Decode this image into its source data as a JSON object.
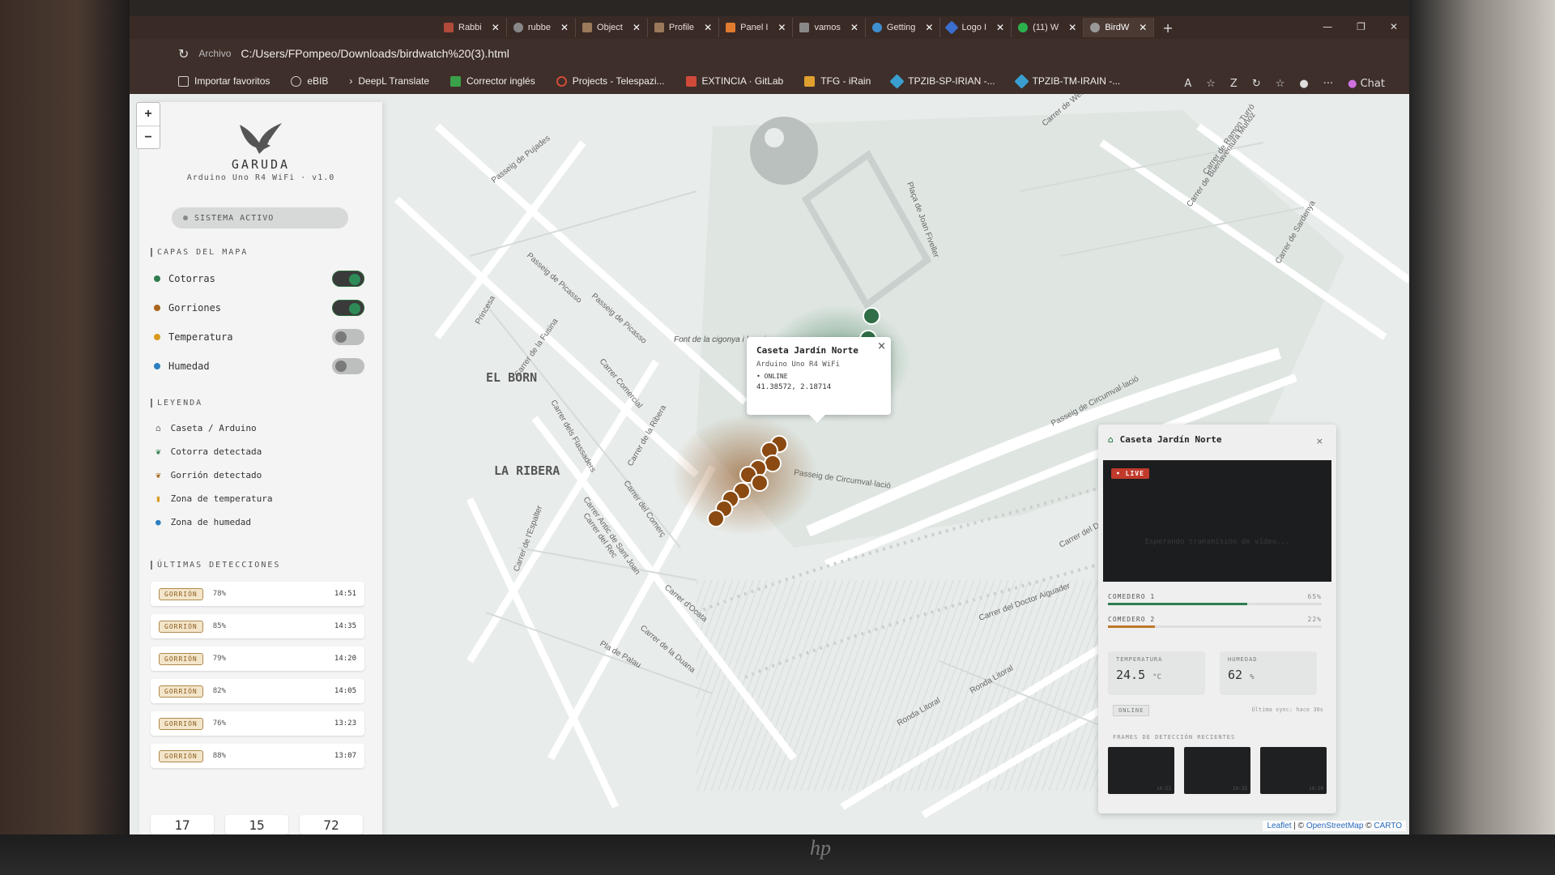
{
  "browser": {
    "tabs": [
      {
        "label": "Rabbi",
        "color": "#b04a3a"
      },
      {
        "label": "rubbe",
        "color": "#888"
      },
      {
        "label": "Object",
        "color": "#9a7a5a"
      },
      {
        "label": "Profile",
        "color": "#9a7a5a"
      },
      {
        "label": "Panel I",
        "color": "#e07b30"
      },
      {
        "label": "vamos",
        "color": "#888"
      },
      {
        "label": "Getting",
        "color": "#3f8fd0"
      },
      {
        "label": "Logo I",
        "color": "#3a6fd0"
      },
      {
        "label": "(11) W",
        "color": "#2bb14c"
      },
      {
        "label": "BirdW",
        "color": "#999"
      }
    ],
    "new_tab": "+",
    "site_info": "Archivo",
    "url": "C:/Users/FPompeo/Downloads/birdwatch%20(3).html",
    "bookmarks": [
      {
        "label": "Importar favoritos",
        "color": "#cfcfcf"
      },
      {
        "label": "eBIB",
        "color": "#cfcfcf"
      },
      {
        "label": "DeepL Translate",
        "color": "#cfcfcf"
      },
      {
        "label": "Corrector inglés",
        "color": "#3aa04a"
      },
      {
        "label": "Projects - Telespazi...",
        "color": "#d04a3a"
      },
      {
        "label": "EXTINCIA · GitLab",
        "color": "#d04a3a"
      },
      {
        "label": "TFG - iRain",
        "color": "#e0a030"
      },
      {
        "label": "TPZIB-SP-IRIAN -...",
        "color": "#3a9fd0"
      },
      {
        "label": "TPZIB-TM-IRAIN -...",
        "color": "#3a9fd0"
      }
    ],
    "chat_label": "Chat"
  },
  "map": {
    "zoom_in": "+",
    "zoom_out": "−",
    "district_labels": [
      "EL BORN",
      "LA RIBERA"
    ],
    "street_labels": [
      "Passeig de Picasso",
      "Passeig de Picasso",
      "Passeig de Pujades",
      "Carrer de la Fusina",
      "Carrer Comercial",
      "Carrer de la Ribera",
      "Carrer del Comerç",
      "Carrer Antic de Sant Joan",
      "Carrer de l'Espalter",
      "Carrer del Rec",
      "Carrer d'Ocata",
      "Carrer de la Duana",
      "Pla de Palau",
      "Passeig de Circumval·lació",
      "Passeig de Circumval·lació",
      "Ronda Litoral",
      "Ronda Litoral",
      "Carrer del Doctor Aiguader",
      "Carrer de Wellington",
      "Plaça de Joan Fiveller",
      "Carrer de Buenaventura Muñoz",
      "Carrer de Sardenya",
      "Carrer de Ramon Turró",
      "Princesa",
      "Carrer dels Flassaders",
      "Carrer del Doctor Aiguader"
    ],
    "poi_label": "Font de la cigonya i la guineu",
    "attribution": {
      "leaflet": "Leaflet",
      "osm": "OpenStreetMap",
      "carto": "CARTO",
      "sep": " | © ",
      "carto_sep": " © "
    }
  },
  "sidebar": {
    "app_name": "GARUDA",
    "subtitle": "Arduino Uno R4 WiFi · v1.0",
    "status": "SISTEMA ACTIVO",
    "layers_title": "CAPAS DEL MAPA",
    "layers": [
      {
        "label": "Cotorras",
        "color": "#2e7d4f",
        "on": true
      },
      {
        "label": "Gorriones",
        "color": "#a8641e",
        "on": true
      },
      {
        "label": "Temperatura",
        "color": "#d99a1f",
        "on": false
      },
      {
        "label": "Humedad",
        "color": "#2c7fc0",
        "on": false
      }
    ],
    "legend_title": "LEYENDA",
    "legend": [
      {
        "label": "Caseta / Arduino",
        "icon": "home-icon"
      },
      {
        "label": "Cotorra detectada",
        "icon": "parrot-leaf-icon"
      },
      {
        "label": "Gorrión detectado",
        "icon": "sparrow-leaf-icon"
      },
      {
        "label": "Zona de temperatura",
        "icon": "thermometer-icon"
      },
      {
        "label": "Zona de humedad",
        "icon": "droplet-icon"
      }
    ],
    "detections_title": "ÚLTIMAS DETECCIONES",
    "detections": [
      {
        "species": "GORRIÓN",
        "confidence": "78%",
        "time": "14:51"
      },
      {
        "species": "GORRIÓN",
        "confidence": "85%",
        "time": "14:35"
      },
      {
        "species": "GORRIÓN",
        "confidence": "79%",
        "time": "14:20"
      },
      {
        "species": "GORRIÓN",
        "confidence": "82%",
        "time": "14:05"
      },
      {
        "species": "GORRIÓN",
        "confidence": "76%",
        "time": "13:23"
      },
      {
        "species": "GORRIÓN",
        "confidence": "88%",
        "time": "13:07"
      }
    ],
    "bottom_stats": [
      "17",
      "15",
      "72"
    ]
  },
  "popup": {
    "title": "Caseta Jardín Norte",
    "subtitle": "Arduino Uno R4 WiFi",
    "status": "• ONLINE",
    "coords": "41.38572, 2.18714",
    "close": "×"
  },
  "panel": {
    "title": "Caseta Jardín Norte",
    "close": "×",
    "live": "• LIVE",
    "cam_message": "Esperando transmisión de vídeo...",
    "feeders": [
      {
        "label": "COMEDERO 1",
        "percent": "65%",
        "fill": 0.65,
        "color": "#2e7d4f"
      },
      {
        "label": "COMEDERO 2",
        "percent": "22%",
        "fill": 0.22,
        "color": "#c0782a"
      }
    ],
    "temperature_label": "TEMPERATURA",
    "temperature_value": "24.5",
    "temperature_unit": "°C",
    "humidity_label": "HUMEDAD",
    "humidity_value": "62",
    "humidity_unit": "%",
    "online": "ONLINE",
    "last_sync": "Última sync: hace 30s",
    "frames_label": "FRAMES DE DETECCIÓN RECIENTES",
    "frame_times": [
      "14:51",
      "14:35",
      "14:20"
    ]
  }
}
